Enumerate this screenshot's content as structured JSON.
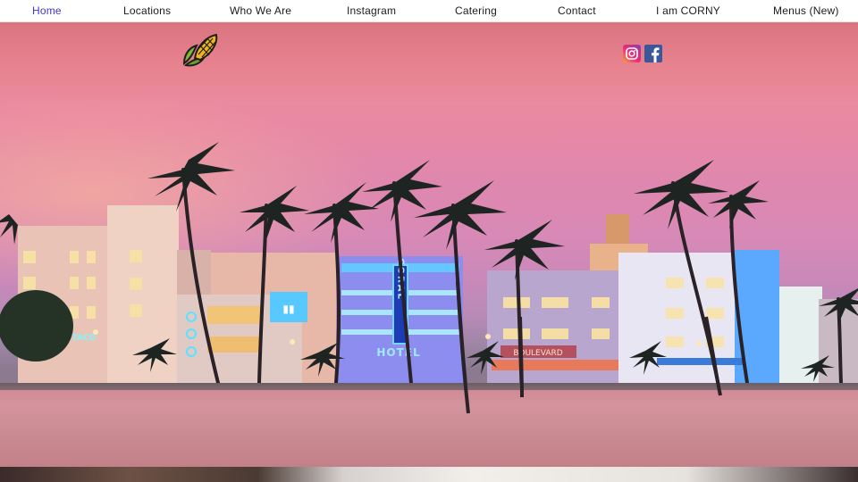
{
  "nav": {
    "items": [
      {
        "label": "Home",
        "active": true
      },
      {
        "label": "Locations",
        "active": false
      },
      {
        "label": "Who We Are",
        "active": false
      },
      {
        "label": "Instagram",
        "active": false
      },
      {
        "label": "Catering",
        "active": false
      },
      {
        "label": "Contact",
        "active": false
      },
      {
        "label": "I am CORNY",
        "active": false
      },
      {
        "label": "Menus (New)",
        "active": false
      }
    ]
  },
  "hero": {
    "logo_icon": "corn-icon",
    "social": [
      {
        "icon": "instagram-icon",
        "color": "#e1306c"
      },
      {
        "icon": "facebook-icon",
        "color": "#3b5998"
      }
    ],
    "signs": {
      "hotel_vertical": "CORAL",
      "hotel_word": "HOTEL",
      "boulevard": "BOULEVARD",
      "left_sign": "TACO"
    }
  },
  "colors": {
    "nav_active": "#3d37c9",
    "neon_blue": "#4fc3ff"
  }
}
